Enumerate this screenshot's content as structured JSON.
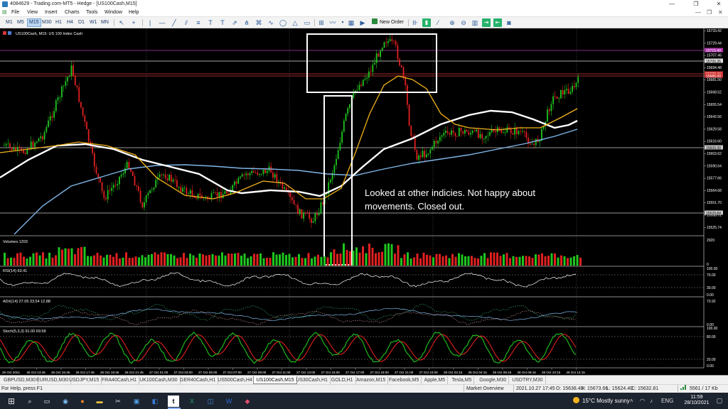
{
  "window": {
    "title": "4084629 - Trading.com-MT5 - Hedge - [US100Cash,M15]",
    "controls": [
      "—",
      "❐",
      "✕"
    ]
  },
  "menu": {
    "items": [
      "File",
      "View",
      "Insert",
      "Charts",
      "Tools",
      "Window",
      "Help"
    ],
    "right_controls": [
      "—",
      "❐",
      "✕"
    ]
  },
  "toolbar": {
    "timeframes": [
      "M1",
      "M5",
      "M15",
      "M30",
      "H1",
      "H4",
      "D1",
      "W1",
      "MN"
    ],
    "active_timeframe": "M15",
    "new_order_label": "New Order"
  },
  "chart": {
    "header": "US100Cash, M15:  US 100 Index Cash",
    "annotation_line1": "Looked at other indicies. Not happy about",
    "annotation_line2": "movements. Closed out.",
    "price_labels": [
      "15733.42",
      "15729.44",
      "15707.46",
      "15694.48",
      "15681.50",
      "15668.52",
      "15655.54",
      "15642.56",
      "15629.58",
      "15616.60",
      "15603.62",
      "15590.64",
      "15577.66",
      "15564.68",
      "15551.70",
      "15538.72",
      "15525.74"
    ],
    "tagged_prices": [
      {
        "label": "15715.40",
        "color": "#b13ab1"
      },
      {
        "label": "15700.35",
        "color": "#dddddd"
      },
      {
        "label": "15688.40",
        "color": "#d43838"
      },
      {
        "label": "15686.00",
        "color": "#d43838"
      },
      {
        "label": "15609.30",
        "color": "#c8c8c8"
      },
      {
        "label": "15529.84",
        "color": "#c8c8c8"
      }
    ],
    "time_labels": [
      "26 Oct 2021",
      "26 Oct 13:45",
      "26 Oct 15:45",
      "26 Oct 17:45",
      "26 Oct 19:45",
      "26 Oct 21:45",
      "27 Oct 01:00",
      "27 Oct 03:00",
      "27 Oct 05:00",
      "27 Oct 07:00",
      "27 Oct 09:00",
      "27 Oct 11:00",
      "27 Oct 13:00",
      "27 Oct 15:00",
      "27 Oct 17:00",
      "27 Oct 19:00",
      "27 Oct 21:00",
      "27 Oct 23:00",
      "28 Oct 02:15",
      "28 Oct 04:15",
      "28 Oct 06:15",
      "28 Oct 08:15",
      "28 Oct 10:15",
      "28 Oct 12:15"
    ],
    "volume": {
      "label": "Volumes 1203",
      "scale_top": "2920",
      "scale_bottom": "0"
    },
    "rsi": {
      "label": "RSI(14) 63.41",
      "scale_top": "100.00",
      "level_high": "70.00",
      "level_low": "30.00",
      "scale_bottom": "0.00"
    },
    "adx": {
      "label": "ADX(14) 27.05 33.54 12.88",
      "scale_top": "73.92",
      "scale_bottom": "0.00"
    },
    "stoch": {
      "label": "Stoch(5,3,3) 91.00 69.58",
      "scale_top": "100.00",
      "level_high": "80.00",
      "level_low": "20.00",
      "scale_bottom": "0.00"
    }
  },
  "tabs": [
    "GBPUSD,M30",
    "EURUSD,M30",
    "USDJPY,M15",
    "FRA40Cash,H1",
    "UK100Cash,M30",
    "GER40Cash,H1",
    "US500Cash,H4",
    "US100Cash,M15",
    "US30Cash,H1",
    "GOLD,H1",
    "Amazon,M15",
    "Facebook,M5",
    "Apple,M5",
    "Tesla,M5",
    "Google,M30",
    "USDTRY,M30"
  ],
  "active_tab": "US100Cash,M15",
  "status": {
    "help": "For Help, press F1",
    "profile": "Market Overview",
    "time": "2021.10.27 17:45",
    "open": "O: 15638.43",
    "high": "H: 15673.66",
    "low": "L: 15624.40",
    "close": "C: 15632.81",
    "traffic": "5561 / 17 Kb"
  },
  "taskbar": {
    "temp": "15°C",
    "weather": "Mostly sunny",
    "time": "11:59",
    "date": "28/10/2021",
    "lang": "ENG"
  },
  "colors": {
    "bull": "#1fc61f",
    "bear": "#e02020",
    "ma_slow": "#ffffff",
    "ma_mid": "#f2b21b",
    "ma_long": "#7fb6e8",
    "stoch_main": "#1fc61f",
    "stoch_signal": "#e02020"
  }
}
